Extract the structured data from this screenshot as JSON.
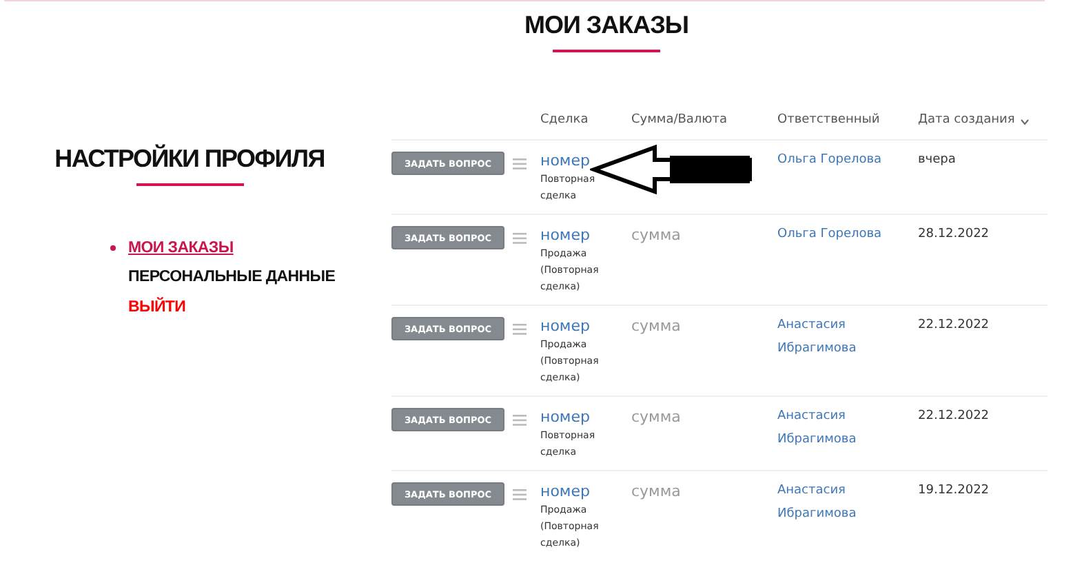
{
  "page_title": "МОИ ЗАКАЗЫ",
  "sidebar": {
    "title": "НАСТРОЙКИ ПРОФИЛЯ",
    "items": [
      {
        "label": "МОИ ЗАКАЗЫ",
        "selected": true,
        "kind": "link"
      },
      {
        "label": "ПЕРСОНАЛЬНЫЕ ДАННЫЕ",
        "selected": false,
        "kind": "link"
      },
      {
        "label": "ВЫЙТИ",
        "selected": false,
        "kind": "logout"
      }
    ]
  },
  "table": {
    "columns": [
      "Сделка",
      "Сумма/Валюта",
      "Ответственный",
      "Дата создания"
    ],
    "rows": [
      {
        "button": "ЗАДАТЬ ВОПРОС",
        "deal": "номер",
        "deal_type": "Повторная сделка",
        "responsible": "Ольга Горелова",
        "date": "вчера",
        "annotated": true
      },
      {
        "button": "ЗАДАТЬ ВОПРОС",
        "deal": "номер",
        "deal_type": "Продажа (Повторная сделка)",
        "sum": "сумма",
        "responsible": "Ольга Горелова",
        "date": "28.12.2022"
      },
      {
        "button": "ЗАДАТЬ ВОПРОС",
        "deal": "номер",
        "deal_type": "Продажа (Повторная сделка)",
        "sum": "сумма",
        "responsible": "Анастасия Ибрагимова",
        "date": "22.12.2022"
      },
      {
        "button": "ЗАДАТЬ ВОПРОС",
        "deal": "номер",
        "deal_type": "Повторная сделка",
        "sum": "сумма",
        "responsible": "Анастасия Ибрагимова",
        "date": "22.12.2022"
      },
      {
        "button": "ЗАДАТЬ ВОПРОС",
        "deal": "номер",
        "deal_type": "Продажа (Повторная сделка)",
        "sum": "сумма",
        "responsible": "Анастасия Ибрагимова",
        "date": "19.12.2022"
      }
    ]
  }
}
